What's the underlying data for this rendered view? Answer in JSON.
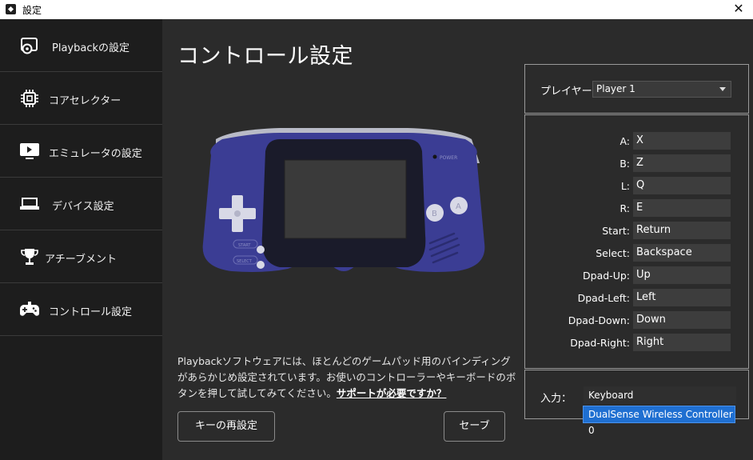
{
  "window": {
    "title": "設定",
    "close_label": "✕"
  },
  "sidebar": {
    "items": [
      {
        "label": "Playbackの設定",
        "icon": "playback-settings-icon"
      },
      {
        "label": "コアセレクター",
        "icon": "chip-icon"
      },
      {
        "label": "エミュレータの設定",
        "icon": "monitor-play-icon"
      },
      {
        "label": "デバイス設定",
        "icon": "device-icon"
      },
      {
        "label": "アチーブメント",
        "icon": "trophy-icon"
      },
      {
        "label": "コントロール設定",
        "icon": "gamepad-icon"
      }
    ]
  },
  "main": {
    "title": "コントロール設定",
    "device_labels": {
      "power": "POWER",
      "start": "START",
      "select": "SELECT",
      "a": "A",
      "b": "B"
    },
    "description": "Playbackソフトウェアには、ほとんどのゲームパッド用のバインディングがあらかじめ設定されています。お使いのコントローラーやキーボードのボタンを押して試してみてください。",
    "support_link": "サポートが必要ですか？",
    "reset_button": "キーの再設定",
    "save_button": "セーブ"
  },
  "player": {
    "label": "プレイヤー:",
    "selected": "Player 1"
  },
  "mappings": [
    {
      "key": "A:",
      "value": "X"
    },
    {
      "key": "B:",
      "value": "Z"
    },
    {
      "key": "L:",
      "value": "Q"
    },
    {
      "key": "R:",
      "value": "E"
    },
    {
      "key": "Start:",
      "value": "Return"
    },
    {
      "key": "Select:",
      "value": "Backspace"
    },
    {
      "key": "Dpad-Up:",
      "value": "Up"
    },
    {
      "key": "Dpad-Left:",
      "value": "Left"
    },
    {
      "key": "Dpad-Down:",
      "value": "Down"
    },
    {
      "key": "Dpad-Right:",
      "value": "Right"
    }
  ],
  "input": {
    "label": "入力：",
    "selected": "Keyboard",
    "options": [
      "DualSense Wireless Controller 0"
    ]
  },
  "colors": {
    "accent": "#1f6fd1",
    "console_body": "#3b3d94",
    "screen": "#3a3a3a"
  }
}
